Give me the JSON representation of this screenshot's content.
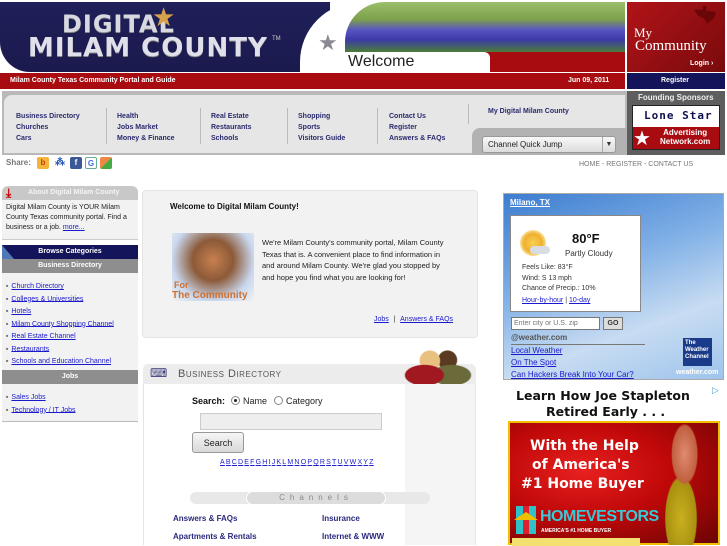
{
  "header": {
    "logo_line1": "DIGITAL",
    "logo_line2": "MILAM COUNTY",
    "logo_tm": "TM",
    "welcome": "Welcome",
    "my_community": {
      "line1": "My",
      "line2": "Community",
      "login": "Login ›"
    },
    "tagline": "Milam County Texas Community Portal and Guide",
    "date": "Jun 09, 2011",
    "register": "Register",
    "colors": {
      "navy": "#1a1a4e",
      "red": "#a80c10"
    }
  },
  "nav": {
    "columns": [
      [
        "Business Directory",
        "Churches",
        "Cars"
      ],
      [
        "Health",
        "Jobs Market",
        "Money & Finance"
      ],
      [
        "Real Estate",
        "Restaurants",
        "Schools"
      ],
      [
        "Shopping",
        "Sports",
        "Visitors Guide"
      ],
      [
        "Contact Us",
        "Register",
        "Answers & FAQs"
      ]
    ],
    "my_digital": "My Digital Milam County",
    "quick_jump": "Channel Quick Jump"
  },
  "sponsors": {
    "title": "Founding Sponsors",
    "lonestar": "Lone Star",
    "advertising": "Advertising",
    "network": "Network.com"
  },
  "share": {
    "label": "Share:",
    "icons": [
      "blogger-icon",
      "delicious-icon",
      "facebook-icon",
      "google-icon",
      "windows-live-icon"
    ]
  },
  "toplinks": [
    "HOME",
    "REGISTER",
    "CONTACT US"
  ],
  "sidebar": {
    "about_title": "About Digital Milam County",
    "about_text": "Digital Milam County is YOUR Milam County Texas community portal. Find a business or a job.",
    "about_more": "more...",
    "browse_title": "Browse Categories",
    "business_title": "Business Directory",
    "business_items": [
      "Church Directory",
      "Colleges & Universities",
      "Hotels",
      "Milam County Shopping Channel",
      "Real Estate Channel",
      "Restaurants",
      "Schools and Education Channel"
    ],
    "jobs_title": "Jobs",
    "jobs_items": [
      "Sales Jobs",
      "Technology / IT Jobs"
    ]
  },
  "welcome": {
    "title": "Welcome to Digital Milam County!",
    "image_for": "For",
    "image_community": "The Community",
    "body": "We're Milam County's community portal, Milam County Texas that is. A convenient place to find information in and around Milam County. We're glad you stopped by and hope you find what you are looking for!",
    "link_jobs": "Jobs",
    "separator": "|",
    "link_faq": "Answers & FAQs"
  },
  "directory": {
    "title": "Business Directory",
    "search_label": "Search:",
    "option_name": "Name",
    "option_category": "Category",
    "selected": "Name",
    "search_value": "",
    "search_button": "Search",
    "alphabet": [
      "A",
      "B",
      "C",
      "D",
      "E",
      "F",
      "G",
      "H",
      "I",
      "J",
      "K",
      "L",
      "M",
      "N",
      "O",
      "P",
      "Q",
      "R",
      "S",
      "T",
      "U",
      "V",
      "W",
      "X",
      "Y",
      "Z"
    ],
    "channels_label": "Channels",
    "channels": [
      [
        "Answers & FAQs",
        "Insurance"
      ],
      [
        "Apartments & Rentals",
        "Internet & WWW"
      ]
    ]
  },
  "weather": {
    "city": "Milano, TX",
    "temp": "80°F",
    "condition": "Partly Cloudy",
    "feels_like": "Feels Like: 83°F",
    "wind": "Wind: S 13 mph",
    "precip": "Chance of Precip.: 10%",
    "link_hourly": "Hour-by-hour",
    "link_10day": "10-day",
    "zip_placeholder": "Enter city or U.S. zip",
    "go": "GO",
    "brand": "@weather.com",
    "links": [
      "Local Weather",
      "On The Spot",
      "Can Hackers Break Into Your Car?"
    ],
    "twc_logo": "The Weather Channel",
    "weathercom": "weather.com"
  },
  "ad": {
    "headline1": "Learn How Joe Stapleton",
    "headline2": "Retired Early . . .",
    "line1": "With the Help",
    "line2": "of America's",
    "line3": "#1 Home Buyer",
    "brand": "HOMEVESTORS",
    "brand_sub": "AMERICA'S #1 HOME BUYER",
    "colors": {
      "bg": "#c00808",
      "border": "#f0c000",
      "brand": "#38c8d8"
    }
  }
}
